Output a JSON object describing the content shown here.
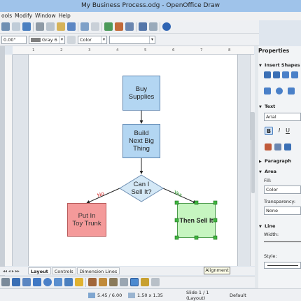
{
  "window": {
    "title": "My Business Process.odg - OpenOffice Draw"
  },
  "menu": {
    "items": [
      "ools",
      "Modify",
      "Window",
      "Help"
    ]
  },
  "toolbar": {
    "position_value": "0.00\"",
    "line_color": "Gray 6",
    "area_style": "Color"
  },
  "ruler": {
    "marks": [
      "1",
      "2",
      "3",
      "4",
      "5",
      "6",
      "7",
      "8"
    ]
  },
  "flowchart": {
    "buy_supplies": "Buy\nSupplies",
    "build_next": "Build\nNext Big\nThing",
    "can_i_sell": "Can I\nSell It?",
    "no_label": "No",
    "yes_label": "Yes",
    "put_in_trunk": "Put In\nToy Trunk",
    "then_sell": "Then Sell It",
    "colors": {
      "process": "#b3d6f2",
      "decision": "#d4e8f6",
      "reject": "#f49a9a",
      "accept": "#c6f5c0",
      "no": "#d02020",
      "yes": "#2a9a2a"
    }
  },
  "tabs": [
    {
      "label": "Layout",
      "active": true
    },
    {
      "label": "Controls",
      "active": false
    },
    {
      "label": "Dimension Lines",
      "active": false
    }
  ],
  "tooltip": {
    "text": "Alignment"
  },
  "status": {
    "position": "5.45 / 6.00",
    "size": "1.50 x 1.35",
    "slide": "Slide 1 / 1 (Layout)",
    "mode": "Default"
  },
  "sidebar": {
    "title": "Properties",
    "insert_shapes": "Insert Shapes",
    "text": "Text",
    "font": "Arial",
    "paragraph": "Paragraph",
    "area": "Area",
    "fill_label": "Fill:",
    "fill_value": "Color",
    "transparency_label": "Transparency:",
    "transparency_value": "None",
    "line": "Line",
    "width_label": "Width:",
    "style_label": "Style:"
  }
}
